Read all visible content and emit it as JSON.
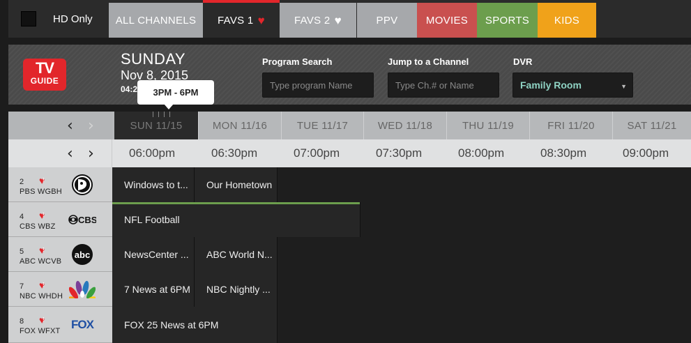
{
  "top_tabs": {
    "hd_label": "HD Only",
    "all": "ALL CHANNELS",
    "favs1": "FAVS 1",
    "favs2": "FAVS 2",
    "ppv": "PPV",
    "movies": "MOVIES",
    "sports": "SPORTS",
    "kids": "KIDS"
  },
  "header": {
    "logo_top": "TV",
    "logo_bottom": "GUIDE",
    "day": "SUNDAY",
    "date": "Nov 8, 2015",
    "time": "04:2",
    "search_label": "Program Search",
    "search_placeholder": "Type program Name",
    "jump_label": "Jump to a Channel",
    "jump_placeholder": "Type Ch.# or Name",
    "dvr_label": "DVR",
    "dvr_value": "Family Room"
  },
  "tooltip": "3PM - 6PM",
  "days": [
    "SUN 11/15",
    "MON 11/16",
    "TUE 11/17",
    "WED 11/18",
    "THU 11/19",
    "FRI 11/20",
    "SAT 11/21"
  ],
  "times": [
    "06:00pm",
    "06:30pm",
    "07:00pm",
    "07:30pm",
    "08:00pm",
    "08:30pm",
    "09:00pm"
  ],
  "channels": [
    {
      "num": "2",
      "call": "PBS WGBH",
      "network": "PBS",
      "programs": [
        "Windows to t...",
        "Our Hometown"
      ]
    },
    {
      "num": "4",
      "call": "CBS WBZ",
      "network": "CBS",
      "programs": [
        "NFL Football"
      ]
    },
    {
      "num": "5",
      "call": "ABC WCVB",
      "network": "abc",
      "programs": [
        "NewsCenter ...",
        "ABC World N..."
      ]
    },
    {
      "num": "7",
      "call": "NBC WHDH",
      "network": "NBC",
      "programs": [
        "7 News at 6PM",
        "NBC Nightly ..."
      ]
    },
    {
      "num": "8",
      "call": "FOX WFXT",
      "network": "FOX",
      "programs": [
        "FOX 25 News at 6PM"
      ]
    }
  ],
  "colors": {
    "accent_red": "#e2262b",
    "movies": "#c9504f",
    "sports": "#6c9e4d",
    "kids": "#f0a21a"
  }
}
